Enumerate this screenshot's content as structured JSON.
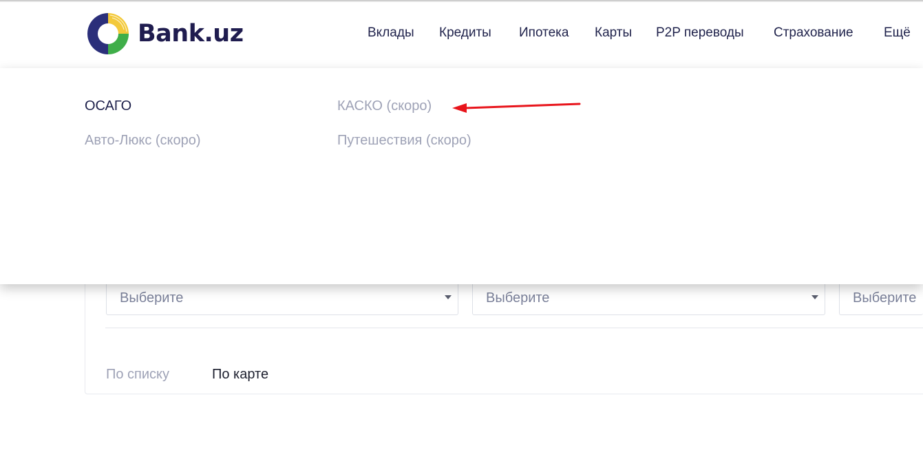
{
  "brand": {
    "name": "Bank.uz",
    "logo_colors": {
      "navy": "#2b2f7a",
      "yellow": "#f3c93a",
      "green": "#3fae49"
    }
  },
  "nav": {
    "items": [
      {
        "label": "Вклады"
      },
      {
        "label": "Кредиты"
      },
      {
        "label": "Ипотека"
      },
      {
        "label": "Карты"
      },
      {
        "label": "P2P переводы"
      },
      {
        "label": "Страхование"
      },
      {
        "label": "Ещё"
      }
    ]
  },
  "insurance_menu": {
    "items": [
      {
        "label": "ОСАГО",
        "state": "active"
      },
      {
        "label": "КАСКО (скоро)",
        "state": "disabled"
      },
      {
        "label": "Авто-Люкс (скоро)",
        "state": "disabled"
      },
      {
        "label": "Путешествия (скоро)",
        "state": "disabled"
      }
    ]
  },
  "filters": {
    "selects": [
      {
        "value": "Выберите"
      },
      {
        "value": "Выберите"
      },
      {
        "value": "Выберите"
      }
    ]
  },
  "view_toggle": {
    "list_label": "По списку",
    "map_label": "По карте"
  },
  "annotation": {
    "arrow_color": "#e8141b",
    "icon": "red-arrow-icon"
  }
}
